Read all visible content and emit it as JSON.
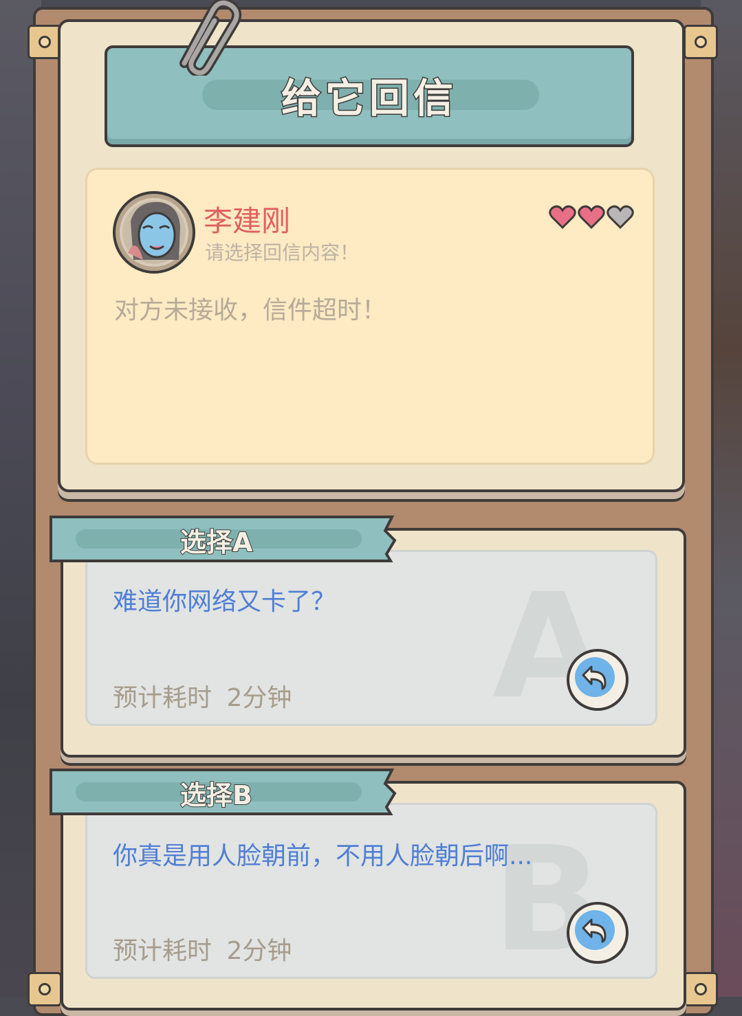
{
  "title": "给它回信",
  "letter": {
    "sender_name": "李建刚",
    "prompt": "请选择回信内容！",
    "body": "对方未接收，信件超时！",
    "affection_hearts": {
      "filled": 2,
      "total": 3
    }
  },
  "options": [
    {
      "label": "选择A",
      "watermark": "A",
      "text": "难道你网络又卡了？",
      "time_label": "预计耗时",
      "time_value": "2分钟"
    },
    {
      "label": "选择B",
      "watermark": "B",
      "text": "你真是用人脸朝前，不用人脸朝后啊...",
      "time_label": "预计耗时",
      "time_value": "2分钟"
    }
  ],
  "icons": {
    "reply": "reply-arrow-icon",
    "heart": "heart-icon",
    "avatar": "sender-avatar"
  },
  "colors": {
    "heart_filled": "#e96f86",
    "heart_empty": "#b8b6b6",
    "name": "#e05f5f",
    "option_text": "#4f7ed6",
    "reply_button": "#6fb3e8"
  }
}
